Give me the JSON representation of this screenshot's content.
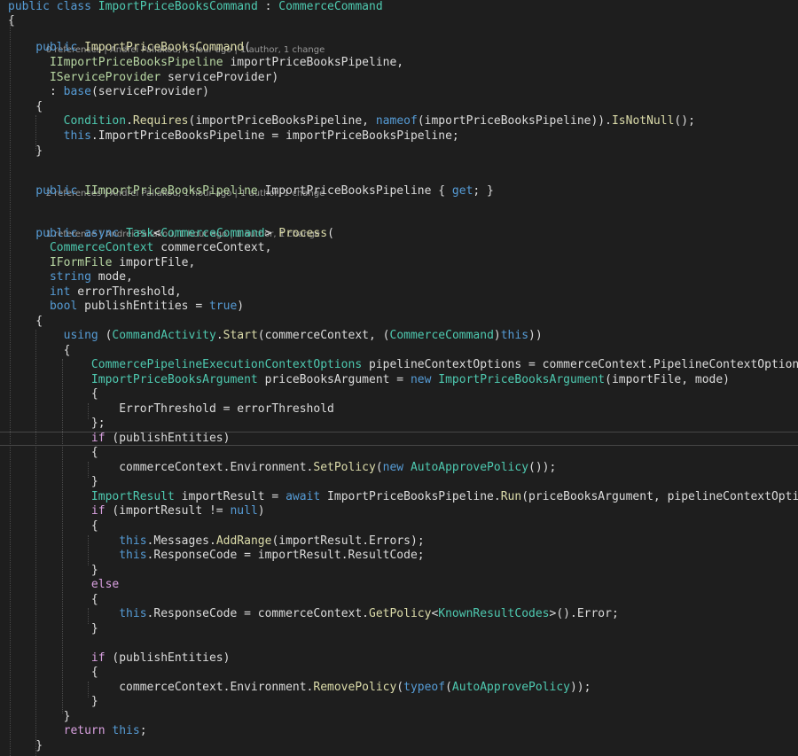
{
  "editor": {
    "colors": {
      "background": "#1e1e1e",
      "keyword": "#569cd6",
      "type": "#4ec9b0",
      "interface": "#b8d7a3",
      "text": "#dcdcdc",
      "codelens": "#999999"
    },
    "codelens": [
      {
        "references": "0 references",
        "author": "Andrei Paliakou, 1 hour ago",
        "changes": "1 author, 1 change"
      },
      {
        "references": "2 references",
        "author": "Andrei Paliakou, 1 hour ago",
        "changes": "1 author, 1 change"
      },
      {
        "references": "1 reference",
        "author": "Andrei Paliakou, 1 hour ago",
        "changes": "1 author, 1 change"
      }
    ],
    "lines": [
      [
        [
          "kw",
          "public "
        ],
        [
          "kw",
          "class "
        ],
        [
          "ty",
          "ImportPriceBooksCommand"
        ],
        [
          "pl",
          " : "
        ],
        [
          "ty",
          "CommerceCommand"
        ]
      ],
      [
        [
          "pl",
          "{"
        ]
      ],
      [
        [
          "kw",
          "    public "
        ],
        [
          "fn",
          "ImportPriceBooksCommand"
        ],
        [
          "pl",
          "("
        ]
      ],
      [
        [
          "it",
          "      IImportPriceBooksPipeline "
        ],
        [
          "pl",
          "importPriceBooksPipeline,"
        ]
      ],
      [
        [
          "it",
          "      IServiceProvider "
        ],
        [
          "pl",
          "serviceProvider)"
        ]
      ],
      [
        [
          "pl",
          "      : "
        ],
        [
          "kw",
          "base"
        ],
        [
          "pl",
          "(serviceProvider)"
        ]
      ],
      [
        [
          "pl",
          "    {"
        ]
      ],
      [
        [
          "ty",
          "        Condition"
        ],
        [
          "pl",
          "."
        ],
        [
          "fn",
          "Requires"
        ],
        [
          "pl",
          "(importPriceBooksPipeline, "
        ],
        [
          "kw",
          "nameof"
        ],
        [
          "pl",
          "(importPriceBooksPipeline))."
        ],
        [
          "fn",
          "IsNotNull"
        ],
        [
          "pl",
          "();"
        ]
      ],
      [
        [
          "kw",
          "        this"
        ],
        [
          "pl",
          ".ImportPriceBooksPipeline = importPriceBooksPipeline;"
        ]
      ],
      [
        [
          "pl",
          "    }"
        ]
      ],
      [
        [
          "kw",
          "    public "
        ],
        [
          "it",
          "IImportPriceBooksPipeline "
        ],
        [
          "pl",
          "ImportPriceBooksPipeline { "
        ],
        [
          "kw",
          "get"
        ],
        [
          "pl",
          "; }"
        ]
      ],
      [
        [
          "kw",
          "    public "
        ],
        [
          "kw",
          "async "
        ],
        [
          "ty",
          "Task"
        ],
        [
          "pl",
          "<"
        ],
        [
          "ty",
          "CommerceCommand"
        ],
        [
          "pl",
          "> "
        ],
        [
          "fn",
          "Process"
        ],
        [
          "pl",
          "("
        ]
      ],
      [
        [
          "ty",
          "      CommerceContext "
        ],
        [
          "pl",
          "commerceContext,"
        ]
      ],
      [
        [
          "it",
          "      IFormFile "
        ],
        [
          "pl",
          "importFile,"
        ]
      ],
      [
        [
          "kw",
          "      string "
        ],
        [
          "pl",
          "mode,"
        ]
      ],
      [
        [
          "kw",
          "      int "
        ],
        [
          "pl",
          "errorThreshold,"
        ]
      ],
      [
        [
          "kw",
          "      bool "
        ],
        [
          "pl",
          "publishEntities = "
        ],
        [
          "kw",
          "true"
        ],
        [
          "pl",
          ")"
        ]
      ],
      [
        [
          "pl",
          "    {"
        ]
      ],
      [
        [
          "kw",
          "        using "
        ],
        [
          "pl",
          "("
        ],
        [
          "ty",
          "CommandActivity"
        ],
        [
          "pl",
          "."
        ],
        [
          "fn",
          "Start"
        ],
        [
          "pl",
          "(commerceContext, ("
        ],
        [
          "ty",
          "CommerceCommand"
        ],
        [
          "pl",
          ")"
        ],
        [
          "kw",
          "this"
        ],
        [
          "pl",
          "))"
        ]
      ],
      [
        [
          "pl",
          "        {"
        ]
      ],
      [
        [
          "ty",
          "            CommercePipelineExecutionContextOptions "
        ],
        [
          "pl",
          "pipelineContextOptions = commerceContext.PipelineContextOptions;"
        ]
      ],
      [
        [
          "ty",
          "            ImportPriceBooksArgument "
        ],
        [
          "pl",
          "priceBooksArgument = "
        ],
        [
          "kw",
          "new "
        ],
        [
          "ty",
          "ImportPriceBooksArgument"
        ],
        [
          "pl",
          "(importFile, mode)"
        ]
      ],
      [
        [
          "pl",
          "            {"
        ]
      ],
      [
        [
          "pl",
          "                ErrorThreshold = errorThreshold"
        ]
      ],
      [
        [
          "pl",
          "            };"
        ]
      ],
      [
        [
          "kc",
          "            if "
        ],
        [
          "pl",
          "(publishEntities)"
        ]
      ],
      [
        [
          "pl",
          "            {"
        ]
      ],
      [
        [
          "pl",
          "                commerceContext.Environment."
        ],
        [
          "fn",
          "SetPolicy"
        ],
        [
          "pl",
          "("
        ],
        [
          "kw",
          "new "
        ],
        [
          "ty",
          "AutoApprovePolicy"
        ],
        [
          "pl",
          "());"
        ]
      ],
      [
        [
          "pl",
          "            }"
        ]
      ],
      [
        [
          "ty",
          "            ImportResult "
        ],
        [
          "pl",
          "importResult = "
        ],
        [
          "kw",
          "await "
        ],
        [
          "pl",
          "ImportPriceBooksPipeline."
        ],
        [
          "fn",
          "Run"
        ],
        [
          "pl",
          "(priceBooksArgument, pipelineContextOptions);"
        ]
      ],
      [
        [
          "kc",
          "            if "
        ],
        [
          "pl",
          "(importResult != "
        ],
        [
          "kw",
          "null"
        ],
        [
          "pl",
          ")"
        ]
      ],
      [
        [
          "pl",
          "            {"
        ]
      ],
      [
        [
          "kw",
          "                this"
        ],
        [
          "pl",
          ".Messages."
        ],
        [
          "fn",
          "AddRange"
        ],
        [
          "pl",
          "(importResult.Errors);"
        ]
      ],
      [
        [
          "kw",
          "                this"
        ],
        [
          "pl",
          ".ResponseCode = importResult.ResultCode;"
        ]
      ],
      [
        [
          "pl",
          "            }"
        ]
      ],
      [
        [
          "kc",
          "            else"
        ]
      ],
      [
        [
          "pl",
          "            {"
        ]
      ],
      [
        [
          "kw",
          "                this"
        ],
        [
          "pl",
          ".ResponseCode = commerceContext."
        ],
        [
          "fn",
          "GetPolicy"
        ],
        [
          "pl",
          "<"
        ],
        [
          "ty",
          "KnownResultCodes"
        ],
        [
          "pl",
          ">().Error;"
        ]
      ],
      [
        [
          "pl",
          "            }"
        ]
      ],
      [
        [
          "kc",
          "            if "
        ],
        [
          "pl",
          "(publishEntities)"
        ]
      ],
      [
        [
          "pl",
          "            {"
        ]
      ],
      [
        [
          "pl",
          "                commerceContext.Environment."
        ],
        [
          "fn",
          "RemovePolicy"
        ],
        [
          "pl",
          "("
        ],
        [
          "kw",
          "typeof"
        ],
        [
          "pl",
          "("
        ],
        [
          "ty",
          "AutoApprovePolicy"
        ],
        [
          "pl",
          "));"
        ]
      ],
      [
        [
          "pl",
          "            }"
        ]
      ],
      [
        [
          "pl",
          "        }"
        ]
      ],
      [
        [
          "kc",
          "        return "
        ],
        [
          "kw",
          "this"
        ],
        [
          "pl",
          ";"
        ]
      ],
      [
        [
          "pl",
          "    }"
        ]
      ]
    ]
  }
}
